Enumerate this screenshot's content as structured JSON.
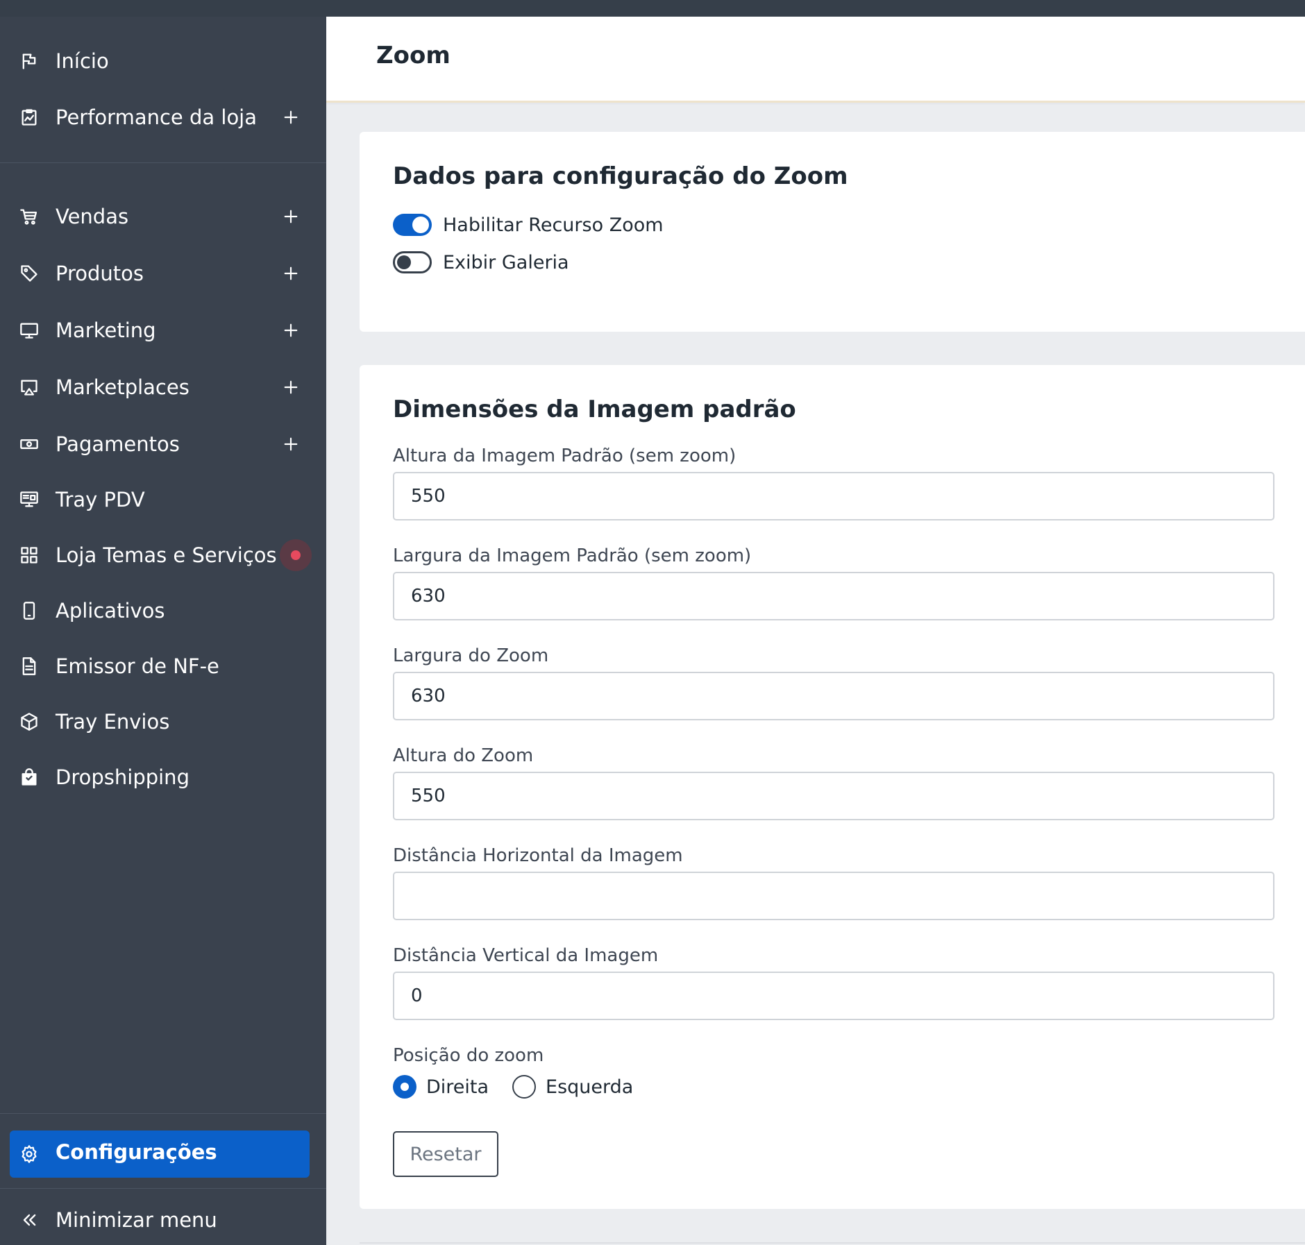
{
  "header": {
    "title": "Zoom"
  },
  "sidebar": {
    "items": [
      {
        "label": "Início",
        "icon": "flag-icon",
        "expandable": false
      },
      {
        "label": "Performance da loja",
        "icon": "chart-clipboard-icon",
        "expandable": true
      },
      {
        "label": "Vendas",
        "icon": "cart-icon",
        "expandable": true
      },
      {
        "label": "Produtos",
        "icon": "tag-icon",
        "expandable": true
      },
      {
        "label": "Marketing",
        "icon": "monitor-icon",
        "expandable": true
      },
      {
        "label": "Marketplaces",
        "icon": "cast-icon",
        "expandable": true
      },
      {
        "label": "Pagamentos",
        "icon": "banknote-icon",
        "expandable": true
      },
      {
        "label": "Tray PDV",
        "icon": "pos-terminal-icon",
        "expandable": false
      },
      {
        "label": "Loja Temas e Serviços",
        "icon": "grid-icon",
        "expandable": false,
        "notification": true
      },
      {
        "label": "Aplicativos",
        "icon": "smartphone-icon",
        "expandable": false
      },
      {
        "label": "Emissor de NF-e",
        "icon": "document-icon",
        "expandable": false
      },
      {
        "label": "Tray Envios",
        "icon": "box-icon",
        "expandable": false
      },
      {
        "label": "Dropshipping",
        "icon": "shopping-bag-icon",
        "expandable": false
      }
    ],
    "active": {
      "label": "Configurações",
      "icon": "gear-icon"
    },
    "minimize": {
      "label": "Minimizar menu",
      "icon": "double-chevron-left-icon"
    }
  },
  "zoom_config": {
    "title": "Dados para configuração do Zoom",
    "toggles": [
      {
        "label": "Habilitar Recurso Zoom",
        "checked": true
      },
      {
        "label": "Exibir Galeria",
        "checked": false
      }
    ]
  },
  "dimensions": {
    "title": "Dimensões da Imagem padrão",
    "fields": [
      {
        "label": "Altura da Imagem Padrão (sem zoom)",
        "value": "550"
      },
      {
        "label": "Largura da Imagem Padrão (sem zoom)",
        "value": "630"
      },
      {
        "label": "Largura do Zoom",
        "value": "630"
      },
      {
        "label": "Altura do Zoom",
        "value": "550"
      },
      {
        "label": "Distância Horizontal da Imagem",
        "value": ""
      },
      {
        "label": "Distância Vertical da Imagem",
        "value": "0"
      }
    ],
    "position": {
      "label": "Posição do zoom",
      "options": [
        {
          "label": "Direita",
          "checked": true
        },
        {
          "label": "Esquerda",
          "checked": false
        }
      ]
    },
    "reset_label": "Resetar"
  },
  "colors": {
    "sidebar_bg": "#3a424e",
    "accent": "#0b60c9",
    "notification_dot": "#e64a5e"
  }
}
